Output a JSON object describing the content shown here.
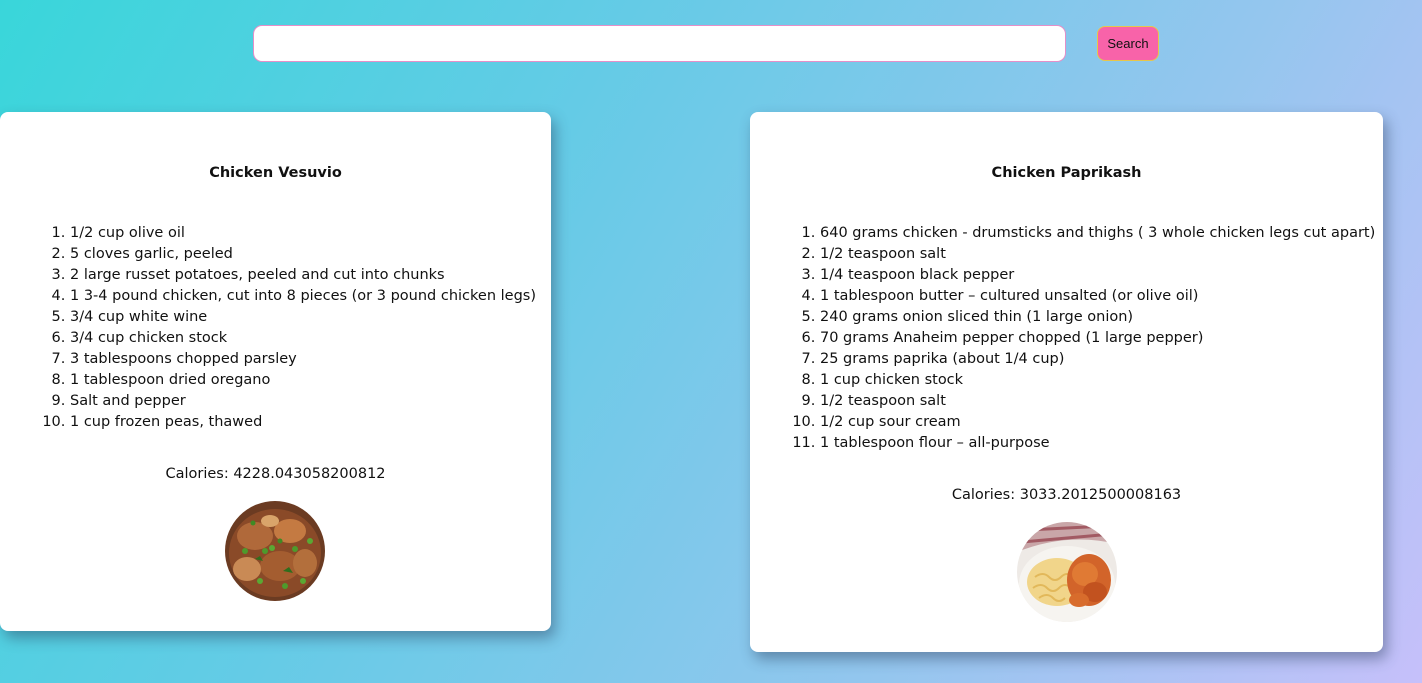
{
  "search": {
    "value": "",
    "placeholder": "",
    "button_label": "Search"
  },
  "recipes": [
    {
      "title": "Chicken Vesuvio",
      "ingredients": [
        "1/2 cup olive oil",
        "5 cloves garlic, peeled",
        "2 large russet potatoes, peeled and cut into chunks",
        "1 3-4 pound chicken, cut into 8 pieces (or 3 pound chicken legs)",
        "3/4 cup white wine",
        "3/4 cup chicken stock",
        "3 tablespoons chopped parsley",
        "1 tablespoon dried oregano",
        "Salt and pepper",
        "1 cup frozen peas, thawed"
      ],
      "calories_label": "Calories: 4228.043058200812",
      "image": "chicken-vesuvio-dish-photo"
    },
    {
      "title": "Chicken Paprikash",
      "ingredients": [
        "640 grams chicken - drumsticks and thighs ( 3 whole chicken legs cut apart)",
        "1/2 teaspoon salt",
        "1/4 teaspoon black pepper",
        "1 tablespoon butter – cultured unsalted (or olive oil)",
        "240 grams onion sliced thin (1 large onion)",
        "70 grams Anaheim pepper chopped (1 large pepper)",
        "25 grams paprika (about 1/4 cup)",
        "1 cup chicken stock",
        "1/2 teaspoon salt",
        "1/2 cup sour cream",
        "1 tablespoon flour – all-purpose"
      ],
      "calories_label": "Calories: 3033.2012500008163",
      "image": "chicken-paprikash-dish-photo"
    }
  ],
  "colors": {
    "search_button": "#f863a9",
    "search_border": "#e58fc8",
    "card_background": "#ffffff"
  }
}
